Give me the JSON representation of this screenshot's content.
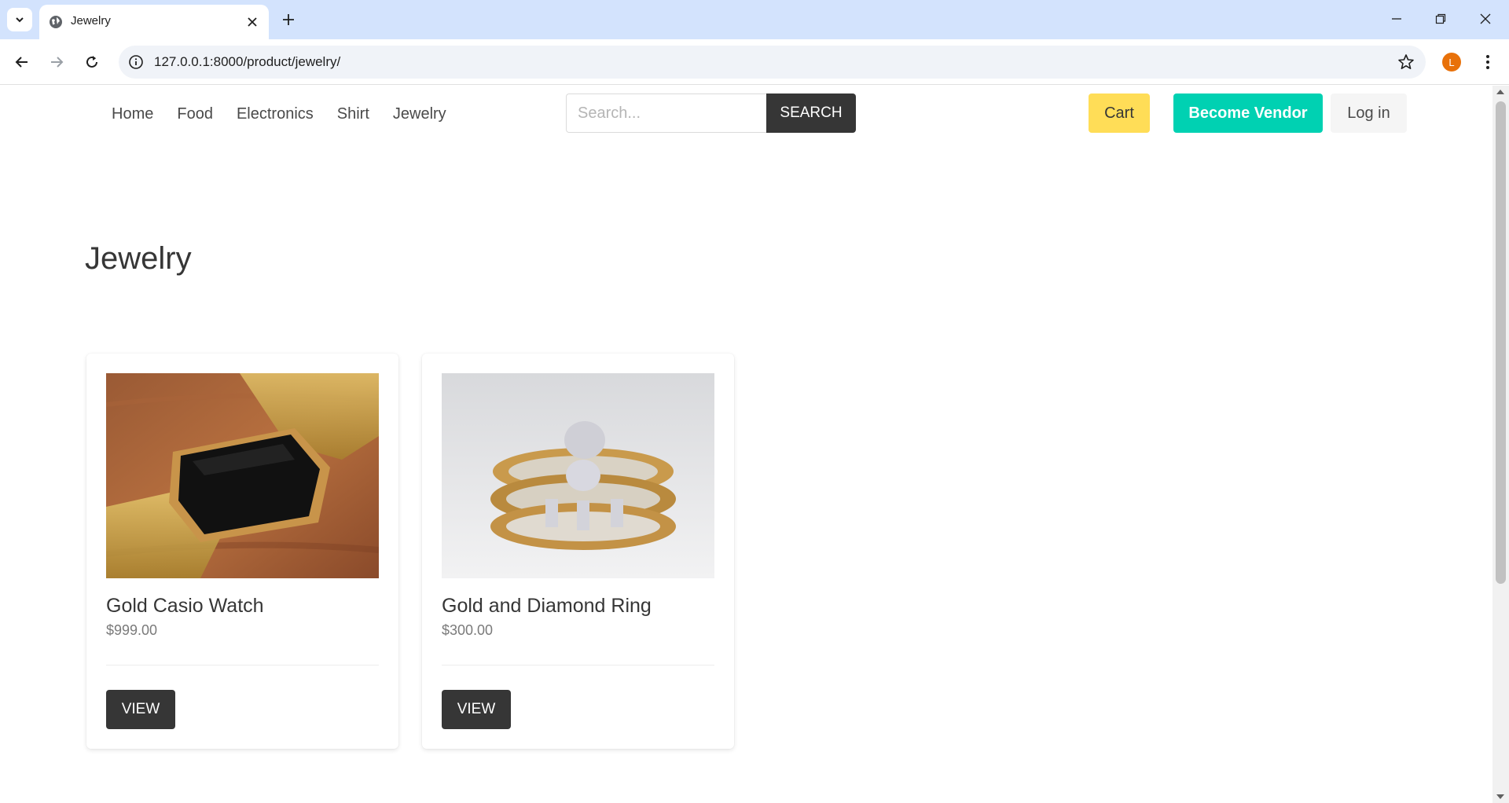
{
  "browser": {
    "tab_title": "Jewelry",
    "url": "127.0.0.1:8000/product/jewelry/",
    "profile_initial": "L"
  },
  "navbar": {
    "links": [
      "Home",
      "Food",
      "Electronics",
      "Shirt",
      "Jewelry"
    ],
    "search_placeholder": "Search...",
    "search_button": "SEARCH",
    "cart_label": "Cart",
    "vendor_label": "Become Vendor",
    "login_label": "Log in"
  },
  "page": {
    "title": "Jewelry"
  },
  "products": [
    {
      "name": "Gold Casio Watch",
      "price": "$999.00",
      "button": "VIEW"
    },
    {
      "name": "Gold and Diamond Ring",
      "price": "$300.00",
      "button": "VIEW"
    }
  ],
  "colors": {
    "cart": "#ffdd57",
    "vendor": "#00d1b2",
    "dark_button": "#363636",
    "tabbar": "#d3e3fd"
  }
}
